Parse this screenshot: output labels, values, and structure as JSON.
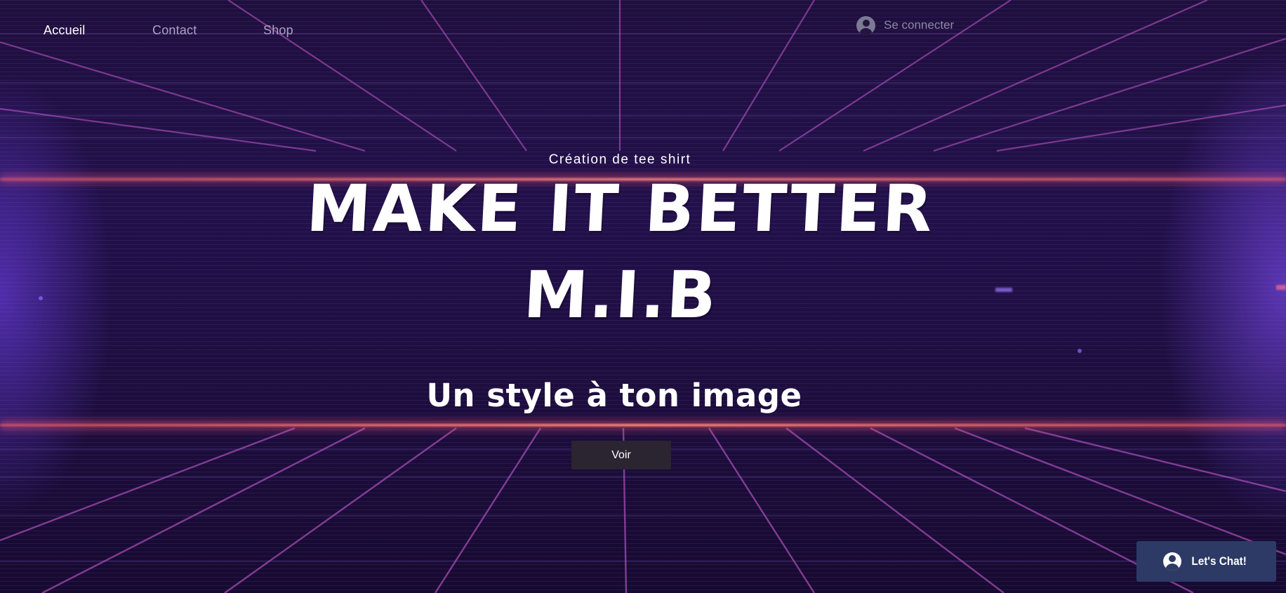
{
  "nav": {
    "items": [
      {
        "label": "Accueil"
      },
      {
        "label": "Contact"
      },
      {
        "label": "Shop"
      }
    ],
    "login_label": "Se connecter"
  },
  "hero": {
    "subtitle": "Création de tee shirt",
    "title_line1": "MAKE IT BETTER",
    "title_line2": "M.I.B",
    "tagline": "Un style à ton image",
    "cta_label": "Voir"
  },
  "chat": {
    "label": "Let's Chat!"
  },
  "colors": {
    "background": "#1f0f3d",
    "grid_line": "#c65bd0",
    "glow_line": "#ff6a6a",
    "cta_bg": "#2a2530",
    "chat_bg": "#2d3a66",
    "nav_inactive": "#a9a2c6"
  },
  "icons": {
    "login": "user-avatar-icon",
    "chat": "user-avatar-icon"
  }
}
